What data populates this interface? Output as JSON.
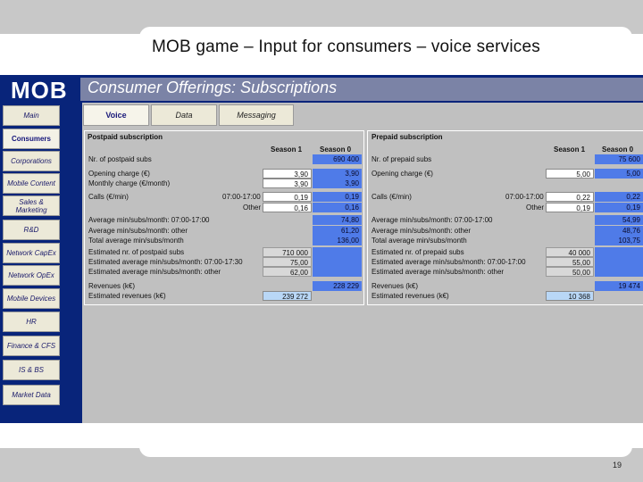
{
  "slide": {
    "title": "MOB game – Input for consumers – voice services",
    "page_number": "19"
  },
  "app": {
    "logo": "MOB",
    "header_title": "Consumer Offerings: Subscriptions"
  },
  "sidebar": {
    "items": [
      {
        "label": "Main"
      },
      {
        "label": "Consumers"
      },
      {
        "label": "Corporations"
      },
      {
        "label": "Mobile Content"
      },
      {
        "label": "Sales & Marketing"
      },
      {
        "label": "R&D"
      },
      {
        "label": "Network CapEx"
      },
      {
        "label": "Network OpEx"
      },
      {
        "label": "Mobile Devices"
      },
      {
        "label": "HR"
      },
      {
        "label": "Finance & CFS"
      },
      {
        "label": "IS & BS"
      },
      {
        "label": "Market Data"
      }
    ]
  },
  "tabs": [
    {
      "label": "Voice"
    },
    {
      "label": "Data"
    },
    {
      "label": "Messaging"
    }
  ],
  "postpaid": {
    "title": "Postpaid subscription",
    "col1": "Season 1",
    "col2": "Season 0",
    "nr_subs_label": "Nr. of postpaid subs",
    "nr_subs_s0": "690 400",
    "opening_label": "Opening charge (€)",
    "opening_s1": "3,90",
    "opening_s0": "3,90",
    "monthly_label": "Monthly charge (€/month)",
    "monthly_s1": "3,90",
    "monthly_s0": "3,90",
    "calls_label": "Calls (€/min)",
    "calls_peak_label": "07:00-17:00",
    "calls_peak_s1": "0,19",
    "calls_peak_s0": "0,19",
    "calls_other_label": "Other",
    "calls_other_s1": "0,16",
    "calls_other_s0": "0,16",
    "avg_peak_label": "Average min/subs/month: 07:00-17:00",
    "avg_peak_s0": "74,80",
    "avg_other_label": "Average min/subs/month: other",
    "avg_other_s0": "61,20",
    "total_label": "Total average min/subs/month",
    "total_s0": "136,00",
    "est_subs_label": "Estimated nr. of postpaid subs",
    "est_subs_s1": "710 000",
    "est_avg_peak_label": "Estimated average min/subs/month: 07:00-17:30",
    "est_avg_peak_s1": "75,00",
    "est_avg_other_label": "Estimated average min/subs/month: other",
    "est_avg_other_s1": "62,00",
    "revenues_label": "Revenues (k€)",
    "revenues_s0": "228 229",
    "est_revenues_label": "Estimated revenues (k€)",
    "est_revenues_s1": "239 272"
  },
  "prepaid": {
    "title": "Prepaid subscription",
    "col1": "Season 1",
    "col2": "Season 0",
    "nr_subs_label": "Nr. of prepaid subs",
    "nr_subs_s0": "75 600",
    "opening_label": "Opening charge (€)",
    "opening_s1": "5,00",
    "opening_s0": "5,00",
    "calls_label": "Calls (€/min)",
    "calls_peak_label": "07:00-17:00",
    "calls_peak_s1": "0,22",
    "calls_peak_s0": "0,22",
    "calls_other_label": "Other",
    "calls_other_s1": "0,19",
    "calls_other_s0": "0,19",
    "avg_peak_label": "Average min/subs/month: 07:00-17:00",
    "avg_peak_s0": "54,99",
    "avg_other_label": "Average min/subs/month: other",
    "avg_other_s0": "48,76",
    "total_label": "Total average min/subs/month",
    "total_s0": "103,75",
    "est_subs_label": "Estimated nr. of prepaid subs",
    "est_subs_s1": "40 000",
    "est_avg_peak_label": "Estimated average min/subs/month: 07:00-17:00",
    "est_avg_peak_s1": "55,00",
    "est_avg_other_label": "Estimated average min/subs/month: other",
    "est_avg_other_s1": "50,00",
    "revenues_label": "Revenues (k€)",
    "revenues_s0": "19 474",
    "est_revenues_label": "Estimated revenues (k€)",
    "est_revenues_s1": "10 368"
  },
  "colors": {
    "app_bg": "#08247a",
    "header_band": "#7b83a6",
    "season0_cell": "#4f7be8",
    "estimate_cell": "#b9d7f6"
  }
}
